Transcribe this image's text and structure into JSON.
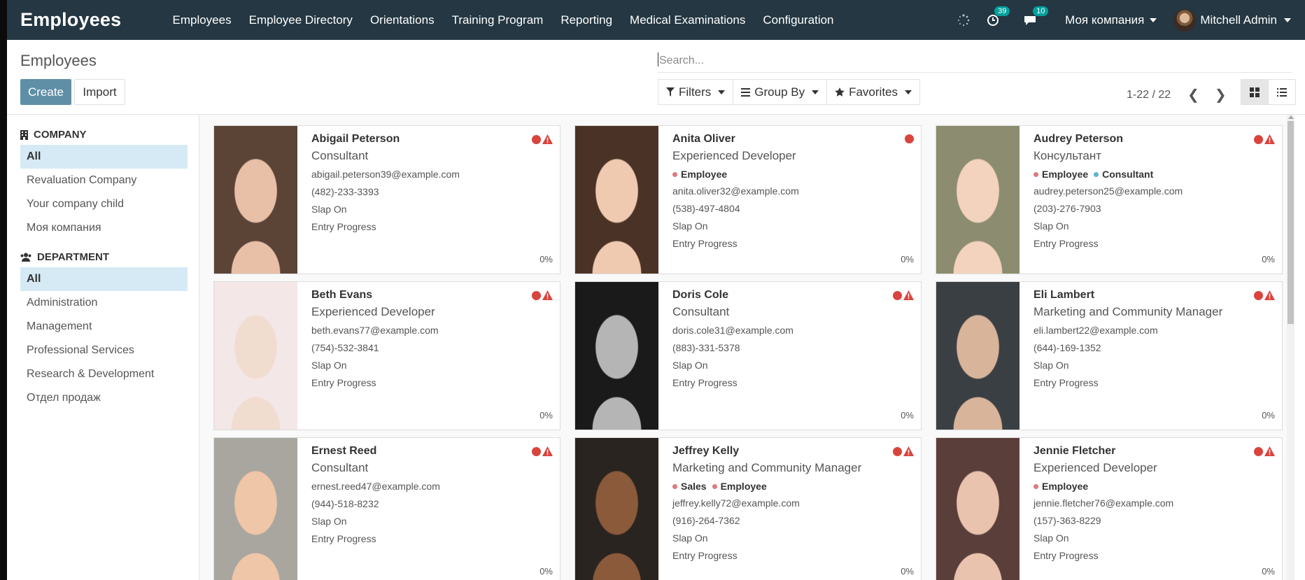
{
  "app": {
    "title": "Employees",
    "menu": [
      "Employees",
      "Employee Directory",
      "Orientations",
      "Training Program",
      "Reporting",
      "Medical Examinations",
      "Configuration"
    ],
    "activity_count": "39",
    "message_count": "10",
    "company": "Моя компания",
    "user": "Mitchell Admin"
  },
  "control": {
    "breadcrumb": "Employees",
    "create_label": "Create",
    "import_label": "Import",
    "search_placeholder": "Search...",
    "filters_label": "Filters",
    "groupby_label": "Group By",
    "favorites_label": "Favorites",
    "pager": "1-22 / 22"
  },
  "sidebar": {
    "company_header": "COMPANY",
    "companies": [
      "All",
      "Revaluation Company",
      "Your company child",
      "Моя компания"
    ],
    "department_header": "DEPARTMENT",
    "departments": [
      "All",
      "Administration",
      "Management",
      "Professional Services",
      "Research & Development",
      "Отдел продаж"
    ]
  },
  "colors": {
    "navbar": "#243742",
    "primary": "#5f8fa7",
    "badge": "#00a09d",
    "status_red": "#d9443c",
    "tag_employee": "#e07a7a",
    "tag_consultant": "#5bb0d6",
    "active_filter": "#d6eaf5"
  },
  "employees": [
    {
      "name": "Abigail Peterson",
      "job": "Consultant",
      "tags": [],
      "email": "abigail.peterson39@example.com",
      "phone": "(482)-233-3393",
      "l1": "Slap On",
      "l2": "Entry Progress",
      "progress": "0%",
      "warning": true,
      "photo_bg": "#5b4436",
      "skin": "#e8c0a8"
    },
    {
      "name": "Anita Oliver",
      "job": "Experienced Developer",
      "tags": [
        "Employee"
      ],
      "email": "anita.oliver32@example.com",
      "phone": "(538)-497-4804",
      "l1": "Slap On",
      "l2": "Entry Progress",
      "progress": "0%",
      "warning": false,
      "photo_bg": "#4a3326",
      "skin": "#f0c9b1"
    },
    {
      "name": "Audrey Peterson",
      "job": "Консультант",
      "tags": [
        "Employee",
        "Consultant"
      ],
      "email": "audrey.peterson25@example.com",
      "phone": "(203)-276-7903",
      "l1": "Slap On",
      "l2": "Entry Progress",
      "progress": "0%",
      "warning": true,
      "photo_bg": "#8c8c70",
      "skin": "#f3d3bd"
    },
    {
      "name": "Beth Evans",
      "job": "Experienced Developer",
      "tags": [],
      "email": "beth.evans77@example.com",
      "phone": "(754)-532-3841",
      "l1": "Slap On",
      "l2": "Entry Progress",
      "progress": "0%",
      "warning": true,
      "photo_bg": "#f3e7e7",
      "skin": "#f1dcd0"
    },
    {
      "name": "Doris Cole",
      "job": "Consultant",
      "tags": [],
      "email": "doris.cole31@example.com",
      "phone": "(883)-331-5378",
      "l1": "Slap On",
      "l2": "Entry Progress",
      "progress": "0%",
      "warning": true,
      "photo_bg": "#1a1a1a",
      "skin": "#b5b5b5"
    },
    {
      "name": "Eli Lambert",
      "job": "Marketing and Community Manager",
      "tags": [],
      "email": "eli.lambert22@example.com",
      "phone": "(644)-169-1352",
      "l1": "Slap On",
      "l2": "Entry Progress",
      "progress": "0%",
      "warning": true,
      "photo_bg": "#3a3f44",
      "skin": "#d8b49a"
    },
    {
      "name": "Ernest Reed",
      "job": "Consultant",
      "tags": [],
      "email": "ernest.reed47@example.com",
      "phone": "(944)-518-8232",
      "l1": "Slap On",
      "l2": "Entry Progress",
      "progress": "0%",
      "warning": true,
      "photo_bg": "#a8a69f",
      "skin": "#efc6a8"
    },
    {
      "name": "Jeffrey Kelly",
      "job": "Marketing and Community Manager",
      "tags": [
        "Sales",
        "Employee"
      ],
      "email": "jeffrey.kelly72@example.com",
      "phone": "(916)-264-7362",
      "l1": "Slap On",
      "l2": "Entry Progress",
      "progress": "0%",
      "warning": true,
      "photo_bg": "#2a2420",
      "skin": "#8a5a3a"
    },
    {
      "name": "Jennie Fletcher",
      "job": "Experienced Developer",
      "tags": [
        "Employee"
      ],
      "email": "jennie.fletcher76@example.com",
      "phone": "(157)-363-8229",
      "l1": "Slap On",
      "l2": "Entry Progress",
      "progress": "0%",
      "warning": true,
      "photo_bg": "#5a3e3a",
      "skin": "#e9c3ae"
    }
  ]
}
